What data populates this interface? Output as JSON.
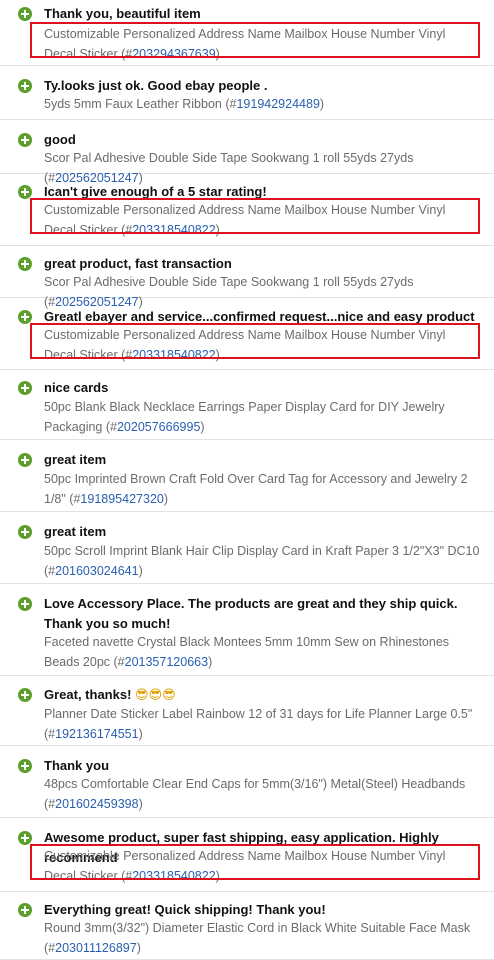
{
  "accent_colors": {
    "plus_icon": "#5c9f2c",
    "item_id_link": "#2a5fb0",
    "highlight_box": "#d9141c"
  },
  "feedback": [
    {
      "comment": "Thank you, beautiful item",
      "product": "Customizable Personalized Address Name Mailbox House Number Vinyl Decal Sticker",
      "item_id": "203294367639",
      "highlighted": true
    },
    {
      "comment": "Ty.looks just ok. Good ebay people .",
      "product": "5yds 5mm Faux Leather Ribbon",
      "item_id": "191942924489",
      "highlighted": false
    },
    {
      "comment": "good",
      "product": "Scor Pal Adhesive Double Side Tape Sookwang 1 roll 55yds 27yds",
      "item_id": "202562051247",
      "highlighted": false
    },
    {
      "comment": "Ican't give enough of a 5 star rating!",
      "product": "Customizable Personalized Address Name Mailbox House Number Vinyl Decal Sticker",
      "item_id": "203318540822",
      "highlighted": true
    },
    {
      "comment": "great product, fast transaction",
      "product": "Scor Pal Adhesive Double Side Tape Sookwang 1 roll 55yds 27yds",
      "item_id": "202562051247",
      "highlighted": false
    },
    {
      "comment": "Greatl ebayer and service...confirmed request...nice and easy product",
      "product": "Customizable Personalized Address Name Mailbox House Number Vinyl Decal Sticker",
      "item_id": "203318540822",
      "highlighted": true
    },
    {
      "comment": "nice cards",
      "product": "50pc Blank Black Necklace Earrings Paper Display Card for DIY Jewelry Packaging",
      "item_id": "202057666995",
      "highlighted": false
    },
    {
      "comment": "great item",
      "product": "50pc Imprinted Brown Craft Fold Over Card Tag for Accessory and Jewelry 2 1/8\"",
      "item_id": "191895427320",
      "highlighted": false
    },
    {
      "comment": "great item",
      "product": "50pc Scroll Imprint Blank Hair Clip Display Card in Kraft Paper 3 1/2\"X3\" DC10",
      "item_id": "201603024641",
      "highlighted": false
    },
    {
      "comment": "Love Accessory Place. The products are great and they ship quick. Thank you so much!",
      "product": "Faceted navette Crystal Black Montees 5mm 10mm Sew on Rhinestones Beads 20pc",
      "item_id": "201357120663",
      "highlighted": false
    },
    {
      "comment": "Great, thanks!",
      "comment_emoji": "😎😎😎",
      "product": "Planner Date Sticker Label Rainbow 12 of 31 days for Life Planner Large 0.5\"",
      "item_id": "192136174551",
      "highlighted": false
    },
    {
      "comment": "Thank you",
      "product": "48pcs Comfortable Clear End Caps for 5mm(3/16\") Metal(Steel) Headbands",
      "item_id": "201602459398",
      "highlighted": false
    },
    {
      "comment": "Awesome product, super fast shipping, easy application. Highly recommend",
      "product": "Customizable Personalized Address Name Mailbox House Number Vinyl Decal Sticker",
      "item_id": "203318540822",
      "highlighted": true
    },
    {
      "comment": "Everything great! Quick shipping! Thank you!",
      "product": "Round 3mm(3/32\") Diameter Elastic Cord in Black White Suitable Face Mask",
      "item_id": "203011126897",
      "highlighted": false
    }
  ]
}
